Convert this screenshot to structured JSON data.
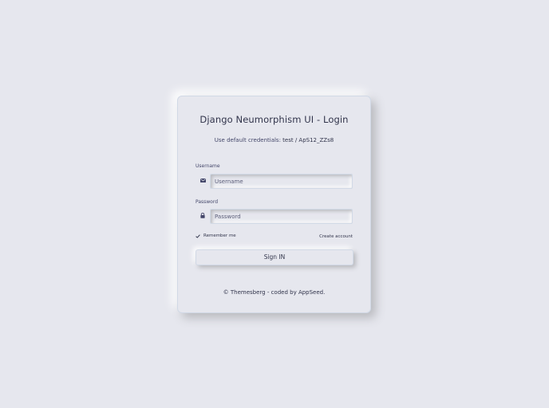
{
  "login": {
    "title": "Django Neumorphism UI - Login",
    "subtitle_prefix": "Use default credentials: ",
    "subtitle_credentials": "test / ApS12_ZZs8",
    "username_label": "Username",
    "username_placeholder": "Username",
    "username_icon": "envelope-icon",
    "password_label": "Password",
    "password_placeholder": "Password",
    "password_icon": "lock-icon",
    "remember_label": "Remember me",
    "remember_checked": true,
    "create_account": "Create account",
    "submit_label": "Sign IN",
    "footer": "© Themesberg - coded by AppSeed."
  },
  "colors": {
    "background": "#e6e7ee",
    "text": "#44476a",
    "text_dark": "#31344b"
  }
}
